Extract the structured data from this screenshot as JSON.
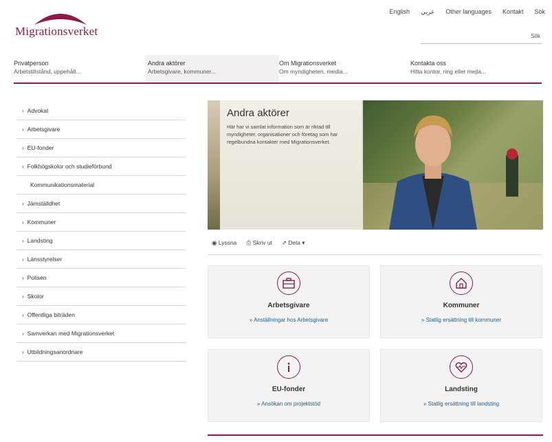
{
  "header": {
    "logo_text": "Migrationsverket",
    "top_links": [
      "English",
      "عربي",
      "Other languages",
      "Kontakt",
      "Sök"
    ],
    "search_button": "Sök"
  },
  "main_nav": [
    {
      "label": "Privatperson",
      "sub": "Arbetstillstånd, uppehåll..."
    },
    {
      "label": "Andra aktörer",
      "sub": "Arbetsgivare, kommuner..."
    },
    {
      "label": "Om Migrationsverket",
      "sub": "Om myndigheten, media..."
    },
    {
      "label": "Kontakta oss",
      "sub": "Hitta kontor, ring eller mejla..."
    }
  ],
  "sidebar": {
    "items": [
      {
        "label": "Advokat",
        "chev": true
      },
      {
        "label": "Arbetsgivare",
        "chev": true
      },
      {
        "label": "EU-fonder",
        "chev": true
      },
      {
        "label": "Folkhögskolor och studieförbund",
        "chev": true
      },
      {
        "label": "Kommunikationsmaterial",
        "chev": false
      },
      {
        "label": "Jämställdhet",
        "chev": true
      },
      {
        "label": "Kommuner",
        "chev": true
      },
      {
        "label": "Landsting",
        "chev": true
      },
      {
        "label": "Länsstyrelser",
        "chev": true
      },
      {
        "label": "Polisen",
        "chev": true
      },
      {
        "label": "Skolor",
        "chev": true
      },
      {
        "label": "Offentliga biträden",
        "chev": true
      },
      {
        "label": "Samverkan med Migrationsverket",
        "chev": true
      },
      {
        "label": "Utbildningsanordnare",
        "chev": true
      }
    ]
  },
  "hero": {
    "title": "Andra aktörer",
    "text": "Här har vi samlat information som är riktad till myndigheter, organisationer och företag som har regelbundna kontakter med Migrationsverket."
  },
  "toolbar": {
    "listen": "Lyssna",
    "print": "Skriv ut",
    "share": "Dela"
  },
  "cards": [
    {
      "title": "Arbetsgivare",
      "link": "» Anställningar hos Arbetsgivare"
    },
    {
      "title": "Kommuner",
      "link": "» Statlig ersättning till kommuner"
    },
    {
      "title": "EU-fonder",
      "link": "» Ansökan om projektstöd"
    },
    {
      "title": "Landsting",
      "link": "» Statlig ersättning till landsting"
    }
  ],
  "colors": {
    "brand": "#8c1b4a",
    "link": "#1f5f8b"
  }
}
